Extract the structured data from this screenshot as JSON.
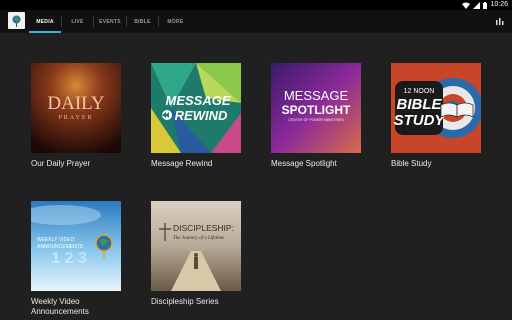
{
  "status": {
    "time": "10:26"
  },
  "tabs": [
    "MEDIA",
    "LIVE",
    "EVENTS",
    "BIBLE",
    "MORE"
  ],
  "colors": {
    "accent": "#33b5e5",
    "background": "#202020",
    "appbar": "#111111"
  },
  "tiles": [
    {
      "caption": "Our Daily Prayer",
      "art_title": "DAILY",
      "art_sub": "PRAYER"
    },
    {
      "caption": "Message Rewind",
      "art_title": "MESSAGE",
      "art_sub": "REWIND"
    },
    {
      "caption": "Message Spotlight",
      "art_title": "MESSAGE",
      "art_sub": "SPOTLIGHT",
      "art_small": "CENTER OF POWER MINISTRIES"
    },
    {
      "caption": "Bible Study",
      "art_top": "12 NOON",
      "art_title": "BIBLE",
      "art_sub": "STUDY"
    },
    {
      "caption": "Weekly Video Announcements",
      "art_title": "WEEKLY VIDEO",
      "art_sub": "ANNOUNCEMENTS"
    },
    {
      "caption": "Discipleship Series",
      "art_title": "DISCIPLESHIP:",
      "art_sub": "The Journey of a Lifetime"
    }
  ]
}
